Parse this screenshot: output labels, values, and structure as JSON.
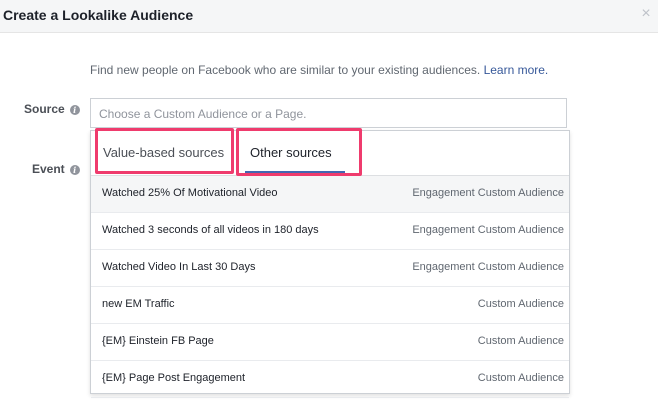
{
  "dialog": {
    "title": "Create a Lookalike Audience",
    "close_glyph": "×",
    "description": "Find new people on Facebook who are similar to your existing audiences.",
    "learn_more": "Learn more."
  },
  "form": {
    "source_label": "Source",
    "event_label": "Event",
    "info_glyph": "i",
    "source_placeholder": "Choose a Custom Audience or a Page."
  },
  "dropdown": {
    "tabs": [
      {
        "label": "Value-based sources",
        "active": false
      },
      {
        "label": "Other sources",
        "active": true
      }
    ],
    "items": [
      {
        "name": "Watched 25% Of Motivational Video",
        "type": "Engagement Custom Audience"
      },
      {
        "name": "Watched 3 seconds of all videos in 180 days",
        "type": "Engagement Custom Audience"
      },
      {
        "name": "Watched Video In Last 30 Days",
        "type": "Engagement Custom Audience"
      },
      {
        "name": "new EM Traffic",
        "type": "Custom Audience"
      },
      {
        "name": "{EM} Einstein FB Page",
        "type": "Custom Audience"
      },
      {
        "name": "{EM} Page Post Engagement",
        "type": "Custom Audience"
      }
    ]
  },
  "colors": {
    "accent": "#4267b2",
    "highlight": "#ef3b6d",
    "link": "#365899"
  },
  "icons": {
    "close": "close-icon",
    "info": "info-icon"
  }
}
